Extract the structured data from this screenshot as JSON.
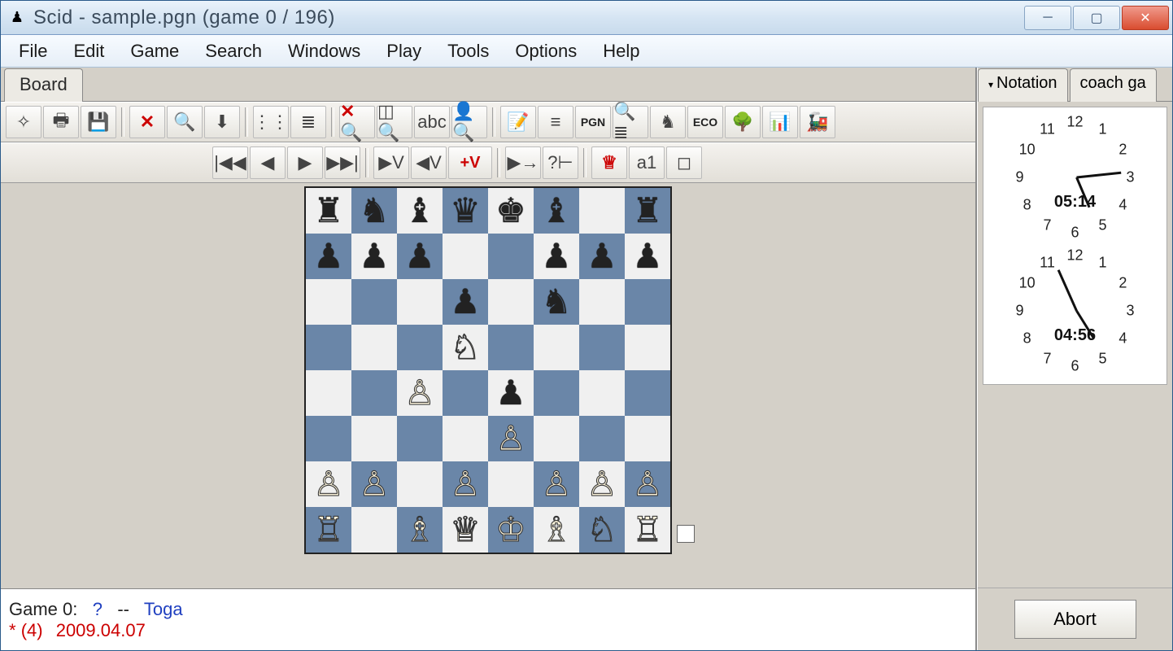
{
  "window": {
    "title": "Scid - sample.pgn (game 0 / 196)"
  },
  "menubar": [
    "File",
    "Edit",
    "Game",
    "Search",
    "Windows",
    "Play",
    "Tools",
    "Options",
    "Help"
  ],
  "board_tab_label": "Board",
  "toolbar1": [
    {
      "name": "new-game-button",
      "glyph": "✧"
    },
    {
      "name": "print-button",
      "glyph": "🖶"
    },
    {
      "name": "save-button",
      "glyph": "💾"
    },
    {
      "sep": true
    },
    {
      "name": "delete-button",
      "glyph": "✕",
      "cls": "red-x"
    },
    {
      "name": "search-game-button",
      "glyph": "🔍"
    },
    {
      "name": "import-button",
      "glyph": "⬇"
    },
    {
      "sep": true
    },
    {
      "name": "setup-board-button",
      "glyph": "⋮⋮"
    },
    {
      "name": "gamelist-button",
      "glyph": "≣"
    },
    {
      "sep": true
    },
    {
      "name": "clear-search-button",
      "glyph": "✕🔍",
      "cls": "red-x"
    },
    {
      "name": "board-search-button",
      "glyph": "◫🔍"
    },
    {
      "name": "header-search-button",
      "glyph": "abc"
    },
    {
      "name": "player-search-button",
      "glyph": "👤🔍"
    },
    {
      "sep": true
    },
    {
      "name": "comment-editor-button",
      "glyph": "📝"
    },
    {
      "name": "gamelist-window-button",
      "glyph": "≡"
    },
    {
      "name": "pgn-window-button",
      "glyph": "PGN",
      "cls": "pgn-btn"
    },
    {
      "name": "tournament-finder-button",
      "glyph": "🔍≣"
    },
    {
      "name": "crosstable-button",
      "glyph": "♞"
    },
    {
      "name": "eco-browser-button",
      "glyph": "ECO",
      "cls": "pgn-btn"
    },
    {
      "name": "tree-window-button",
      "glyph": "🌳"
    },
    {
      "name": "stats-window-button",
      "glyph": "📊"
    },
    {
      "name": "engine-button",
      "glyph": "🚂"
    }
  ],
  "toolbar2": [
    {
      "name": "nav-start-button",
      "glyph": "|◀◀"
    },
    {
      "name": "nav-back-button",
      "glyph": "◀"
    },
    {
      "name": "nav-forward-button",
      "glyph": "▶"
    },
    {
      "name": "nav-end-button",
      "glyph": "▶▶|"
    },
    {
      "sep": true
    },
    {
      "name": "variation-enter-button",
      "glyph": "▶V"
    },
    {
      "name": "variation-exit-button",
      "glyph": "◀V"
    },
    {
      "name": "variation-add-button",
      "glyph": "+V",
      "cls": "addv"
    },
    {
      "sep": true
    },
    {
      "name": "autoplay-button",
      "glyph": "▶→"
    },
    {
      "name": "help-analysis-button",
      "glyph": "?⊢"
    },
    {
      "sep": true
    },
    {
      "name": "book-button",
      "glyph": "♕",
      "cls": "red-x"
    },
    {
      "name": "coords-toggle-button",
      "glyph": "a1"
    },
    {
      "name": "material-toggle-button",
      "glyph": "◻"
    }
  ],
  "board": {
    "rows": [
      "rnbqkb.r",
      "ppp..ppp",
      "...p.n..",
      "...N....",
      "..P.p...",
      "....P...",
      "PP.P.PPP",
      "R.BQKBNR"
    ]
  },
  "status": {
    "prefix": "Game 0:",
    "white": "?",
    "sep": "--",
    "black": "Toga",
    "star": "*",
    "moves": "(4)",
    "date": "2009.04.07"
  },
  "right_tabs": [
    {
      "name": "tab-notation",
      "label": "Notation",
      "active": true
    },
    {
      "name": "tab-coach",
      "label": "coach ga",
      "active": false
    }
  ],
  "clocks": [
    {
      "name": "clock-white",
      "digital": "05:14"
    },
    {
      "name": "clock-black",
      "digital": "04:56"
    }
  ],
  "abort_label": "Abort",
  "clock_numbers": [
    "12",
    "1",
    "2",
    "3",
    "4",
    "5",
    "6",
    "7",
    "8",
    "9",
    "10",
    "11"
  ]
}
